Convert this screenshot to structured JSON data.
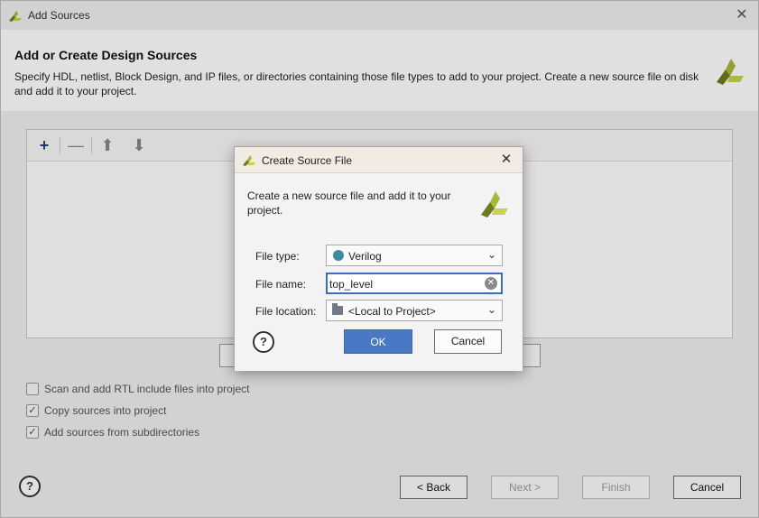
{
  "window": {
    "title": "Add Sources",
    "close_glyph": "✕"
  },
  "header": {
    "title": "Add or Create Design Sources",
    "description": "Specify HDL, netlist, Block Design, and IP files, or directories containing those file types to add to your project. Create a new source file on disk and add it to your project."
  },
  "toolbar": {
    "add_glyph": "+",
    "remove_glyph": "—",
    "up_glyph": "⬆",
    "down_glyph": "⬇"
  },
  "options": [
    {
      "label": "Scan and add RTL include files into project",
      "checked": false
    },
    {
      "label": "Copy sources into project",
      "checked": true
    },
    {
      "label": "Add sources from subdirectories",
      "checked": true
    }
  ],
  "footer": {
    "help": "?",
    "back": "< Back",
    "next": "Next >",
    "finish": "Finish",
    "cancel": "Cancel"
  },
  "dialog": {
    "title": "Create Source File",
    "close_glyph": "✕",
    "description": "Create a new source file and add it to your project.",
    "file_type_label": "File type:",
    "file_type_value": "Verilog",
    "file_name_label": "File name:",
    "file_name_value": "top_level",
    "file_location_label": "File location:",
    "file_location_value": "<Local to Project>",
    "help": "?",
    "ok": "OK",
    "cancel": "Cancel"
  },
  "colors": {
    "accent": "#4a78c4",
    "verilog_dot": "#3c8c9c",
    "logo_green": "#7a8a1e"
  },
  "icons": [
    "vivado-logo-icon",
    "close-icon",
    "add-icon",
    "remove-icon",
    "move-up-icon",
    "move-down-icon",
    "help-icon",
    "chevron-down-icon",
    "clear-icon",
    "folder-icon"
  ]
}
